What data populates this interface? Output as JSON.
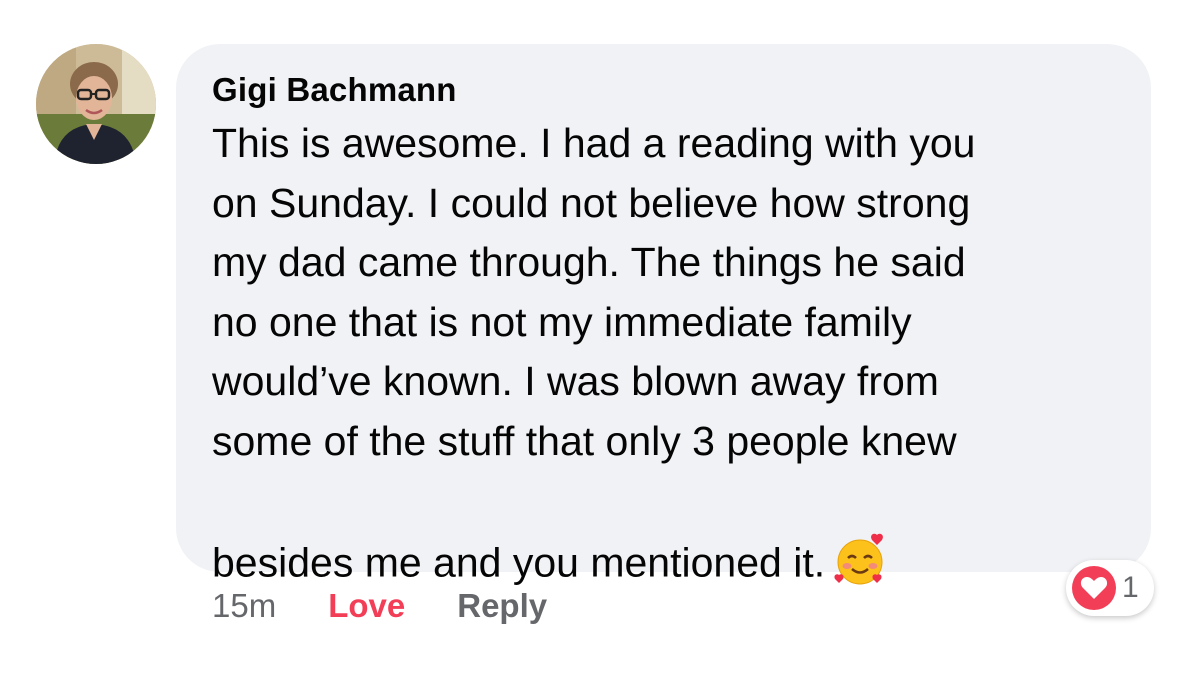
{
  "comment": {
    "author": "Gigi Bachmann",
    "text": "This is awesome. I had a reading with you\non Sunday. I could not believe how strong\nmy dad came through. The things he said\nno one that is not my immediate family\nwould’ve known. I was blown away from\nsome of the stuff that only 3 people knew\nbesides me and  you mentioned it.",
    "emoji": "smiling-face-with-hearts-icon"
  },
  "meta": {
    "time": "15m",
    "love_label": "Love",
    "reply_label": "Reply"
  },
  "reactions": {
    "icon": "heart-icon",
    "count": "1"
  },
  "colors": {
    "bubble": "#f0f2f5",
    "love": "#f33e58",
    "muted": "#65676b",
    "text": "#050505"
  }
}
